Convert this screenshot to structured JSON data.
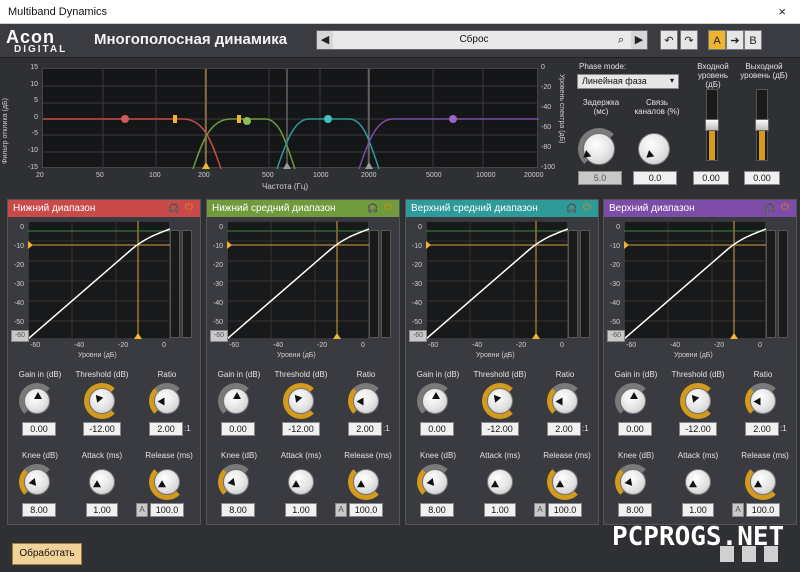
{
  "window": {
    "title": "Multiband Dynamics",
    "close": "×"
  },
  "logo": {
    "brand": "Acon",
    "sub": "DIGITAL"
  },
  "plugin_title": "Многополосная динамика",
  "preset": {
    "name": "Сброс",
    "prev": "◀",
    "next": "▶",
    "search": "⌕"
  },
  "toolbar": {
    "undo": "↶",
    "redo": "↷",
    "a": "A",
    "arrow": "➔",
    "b": "B"
  },
  "graph": {
    "left_axis_title": "Фильтр отклика (дБ)",
    "right_axis_title": "Уровень спектра (дБ)",
    "x_title": "Частота (Гц)",
    "left_ticks": [
      "15",
      "10",
      "5",
      "0",
      "-5",
      "-10",
      "-15"
    ],
    "right_ticks": [
      "0",
      "-20",
      "-40",
      "-60",
      "-80",
      "-100"
    ],
    "x_ticks": [
      "20",
      "50",
      "100",
      "200",
      "500",
      "1000",
      "2000",
      "5000",
      "10000",
      "20000"
    ]
  },
  "side": {
    "phase_mode_label": "Phase mode:",
    "phase_mode_value": "Линейная фаза",
    "latency_label": "Задержка (мс)",
    "latency_value": "5.0",
    "link_label": "Связь каналов (%)",
    "link_value": "0.0",
    "input_label": "Входной уровень (дБ)",
    "input_value": "0.00",
    "output_label": "Выходной уровень (дБ)",
    "output_value": "0.00"
  },
  "bands": [
    {
      "name": "Нижний диапазон",
      "color": "#c94b49",
      "gain": "0.00",
      "threshold": "-12.00",
      "ratio": "2.00",
      "knee": "8.00",
      "attack": "1.00",
      "release": "100.0"
    },
    {
      "name": "Нижний средний диапазон",
      "color": "#6f9b3c",
      "gain": "0.00",
      "threshold": "-12.00",
      "ratio": "2.00",
      "knee": "8.00",
      "attack": "1.00",
      "release": "100.0"
    },
    {
      "name": "Верхний средний диапазон",
      "color": "#2e9a9a",
      "gain": "0.00",
      "threshold": "-12.00",
      "ratio": "2.00",
      "knee": "8.00",
      "attack": "1.00",
      "release": "100.0"
    },
    {
      "name": "Верхний диапазон",
      "color": "#7c4ca6",
      "gain": "0.00",
      "threshold": "-12.00",
      "ratio": "2.00",
      "knee": "8.00",
      "attack": "1.00",
      "release": "100.0"
    }
  ],
  "band_labels": {
    "gain": "Gain in (dB)",
    "threshold": "Threshold (dB)",
    "ratio": "Ratio",
    "knee": "Knee (dB)",
    "attack": "Attack (ms)",
    "release": "Release (ms)",
    "ratio_suffix": ":1",
    "auto": "A",
    "levels_title": "Уровни (дБ)",
    "y_ticks": [
      "0",
      "-10",
      "-20",
      "-30",
      "-40",
      "-50"
    ],
    "x_ticks": [
      "-60",
      "-40",
      "-20",
      "0"
    ],
    "corner": "-60",
    "headphone": "🎧",
    "power": "⏻"
  },
  "footer": {
    "process": "Обработать",
    "watermark": "PCPROGS.NET"
  }
}
